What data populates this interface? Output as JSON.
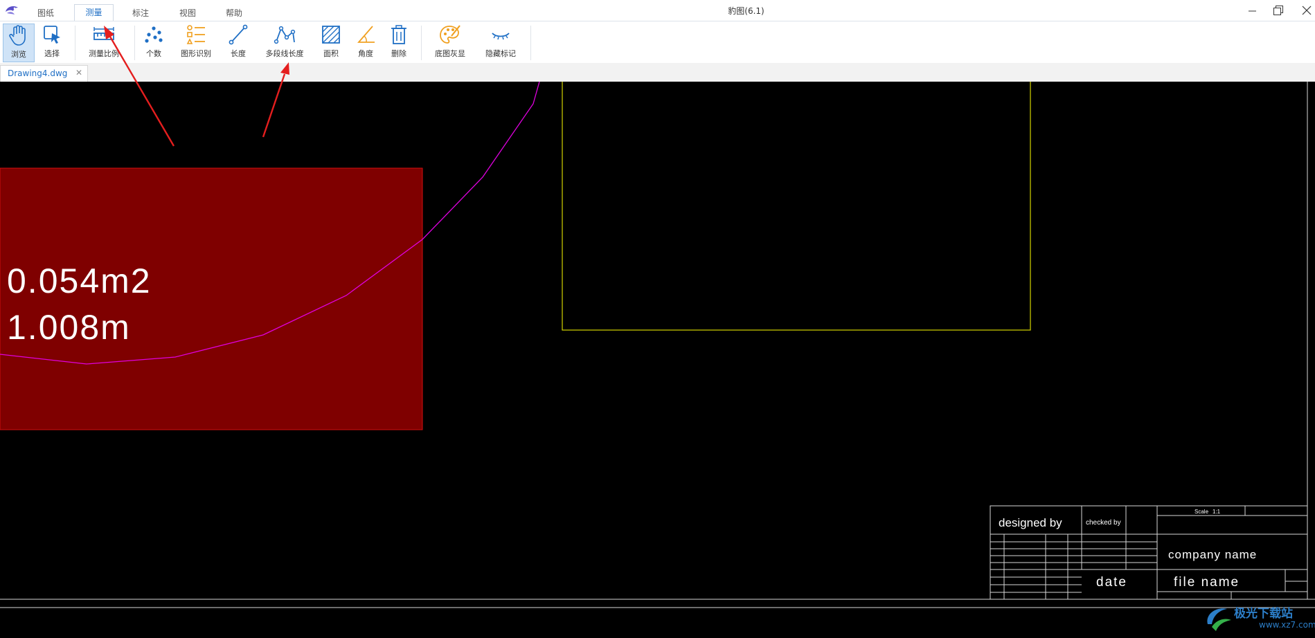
{
  "window": {
    "title": "豹图(6.1)"
  },
  "menu_tabs": [
    {
      "label": "图纸"
    },
    {
      "label": "测量",
      "active": true
    },
    {
      "label": "标注"
    },
    {
      "label": "视图"
    },
    {
      "label": "帮助"
    }
  ],
  "ribbon": {
    "tools": [
      {
        "label": "浏览",
        "icon": "hand-icon",
        "active": true
      },
      {
        "label": "选择",
        "icon": "select-cursor-icon"
      },
      {
        "label": "测量比例",
        "icon": "ruler-scale-icon"
      },
      {
        "label": "个数",
        "icon": "count-dots-icon"
      },
      {
        "label": "图形识别",
        "icon": "shape-recognition-icon"
      },
      {
        "label": "长度",
        "icon": "length-icon"
      },
      {
        "label": "多段线长度",
        "icon": "polyline-length-icon"
      },
      {
        "label": "面积",
        "icon": "area-icon"
      },
      {
        "label": "角度",
        "icon": "angle-icon"
      },
      {
        "label": "删除",
        "icon": "trash-icon"
      },
      {
        "label": "底图灰显",
        "icon": "palette-icon"
      },
      {
        "label": "隐藏标记",
        "icon": "eye-closed-icon"
      }
    ]
  },
  "document_tab": {
    "name": "Drawing4.dwg",
    "close_glyph": "✕"
  },
  "drawing": {
    "measurement_area": "0.054m2",
    "measurement_length": "1.008m",
    "title_block": {
      "designed_by": "designed by",
      "checked_by": "checked by",
      "scale_label": "Scale",
      "scale_value": "1:1",
      "company_name": "company name",
      "date": "date",
      "file_name": "file name"
    }
  },
  "watermark": {
    "title": "极光下载站",
    "url": "www.xz7.com"
  },
  "colors": {
    "accent": "#1f6fc5",
    "measure_fill": "#7f0000",
    "polyline": "#e000e0",
    "yellow_rect": "#d4d400",
    "annotation_arrow": "#e41e1e"
  }
}
